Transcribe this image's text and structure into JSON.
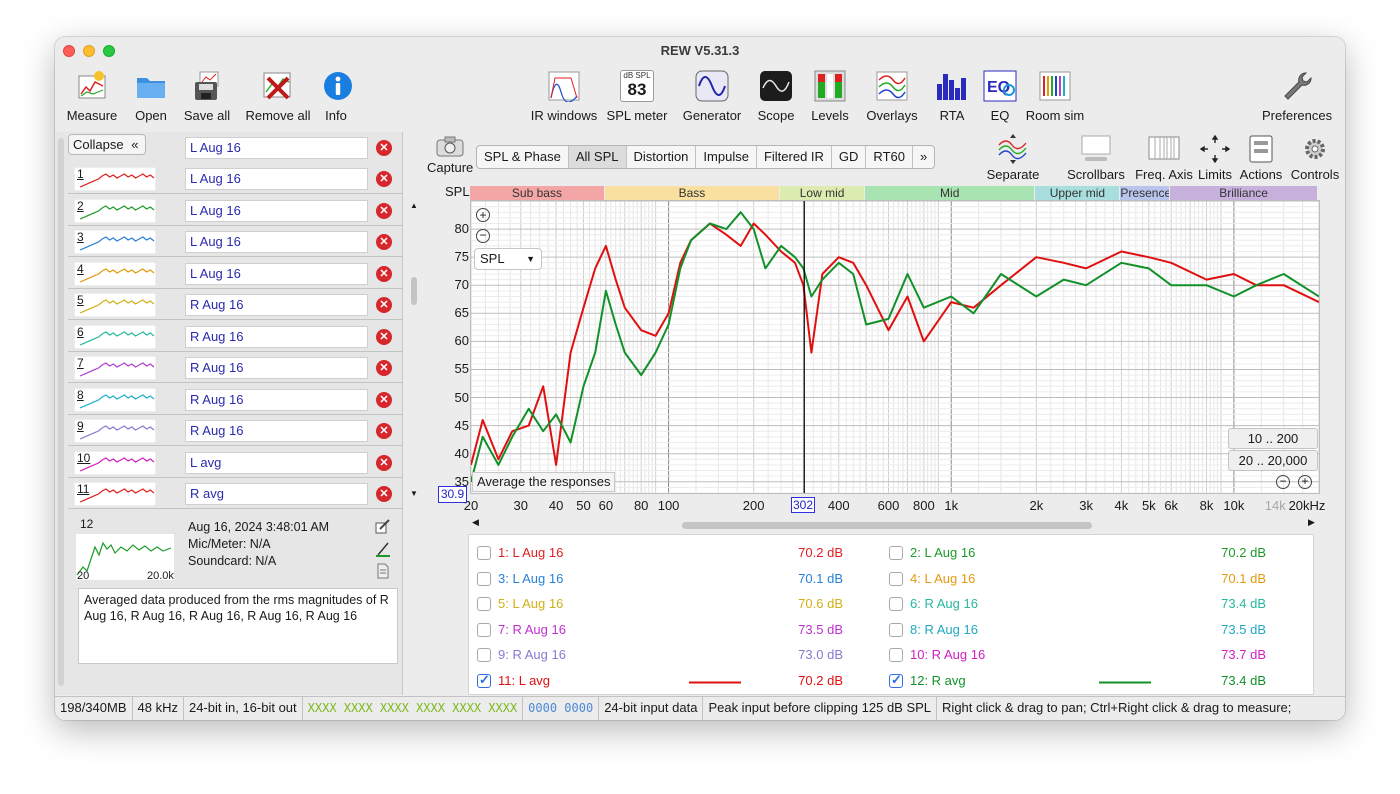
{
  "window": {
    "title": "REW V5.31.3"
  },
  "toolbar": {
    "left": [
      {
        "name": "measure-button",
        "icon": "measure-icon",
        "label": "Measure"
      },
      {
        "name": "open-button",
        "icon": "folder-icon",
        "label": "Open"
      },
      {
        "name": "save-all-button",
        "icon": "save-icon",
        "label": "Save all"
      },
      {
        "name": "remove-all-button",
        "icon": "remove-icon",
        "label": "Remove all"
      },
      {
        "name": "info-button",
        "icon": "info-icon",
        "label": "Info"
      }
    ],
    "center": [
      {
        "name": "ir-windows-button",
        "icon": "ir-windows-icon",
        "label": "IR windows"
      },
      {
        "name": "spl-meter-button",
        "icon": "spl-meter-icon",
        "label": "SPL meter",
        "meter_caption": "dB SPL",
        "meter_value": "83"
      },
      {
        "name": "generator-button",
        "icon": "sine-wave-icon",
        "label": "Generator"
      },
      {
        "name": "scope-button",
        "icon": "scope-icon",
        "label": "Scope"
      },
      {
        "name": "levels-button",
        "icon": "levels-icon",
        "label": "Levels"
      },
      {
        "name": "overlays-button",
        "icon": "overlays-icon",
        "label": "Overlays"
      },
      {
        "name": "rta-button",
        "icon": "rta-icon",
        "label": "RTA"
      },
      {
        "name": "eq-button",
        "icon": "eq-icon",
        "label": "EQ"
      },
      {
        "name": "room-sim-button",
        "icon": "room-sim-icon",
        "label": "Room sim"
      }
    ],
    "right": [
      {
        "name": "preferences-button",
        "icon": "wrench-icon",
        "label": "Preferences"
      }
    ]
  },
  "left_panel": {
    "collapse_label": "Collapse",
    "collapse_glyph": "«",
    "header_name": "L Aug 16",
    "measurements": [
      {
        "num": "1",
        "name": "L Aug 16",
        "color": "#e02020"
      },
      {
        "num": "2",
        "name": "L Aug 16",
        "color": "#1e9a2a"
      },
      {
        "num": "3",
        "name": "L Aug 16",
        "color": "#2a7fd8"
      },
      {
        "num": "4",
        "name": "L Aug 16",
        "color": "#e39a10"
      },
      {
        "num": "5",
        "name": "R Aug 16",
        "color": "#d2b01a"
      },
      {
        "num": "6",
        "name": "R Aug 16",
        "color": "#27b8a0"
      },
      {
        "num": "7",
        "name": "R Aug 16",
        "color": "#b040d0"
      },
      {
        "num": "8",
        "name": "R Aug 16",
        "color": "#20b0c8"
      },
      {
        "num": "9",
        "name": "R Aug 16",
        "color": "#8a7ad0"
      },
      {
        "num": "10",
        "name": "L avg",
        "color": "#d020c0"
      },
      {
        "num": "11",
        "name": "R avg",
        "color": "#e02020"
      }
    ],
    "selected": {
      "num": "12",
      "date": "Aug 16, 2024 3:48:01 AM",
      "mic": "Mic/Meter: N/A",
      "soundcard": "Soundcard: N/A",
      "thumb_left": "20",
      "thumb_right": "20.0k",
      "color": "#1e9a2a",
      "description": "Averaged data produced from the rms magnitudes of R Aug 16, R Aug 16, R Aug 16, R Aug 16, R Aug 16"
    }
  },
  "graph_toolbar": {
    "capture_label": "Capture",
    "tabs": [
      "SPL & Phase",
      "All SPL",
      "Distortion",
      "Impulse",
      "Filtered IR",
      "GD",
      "RT60",
      "»"
    ],
    "active_tab": "All SPL",
    "right_buttons": [
      {
        "name": "separate-button",
        "icon": "separate-icon",
        "label": "Separate"
      },
      {
        "name": "scrollbars-button",
        "icon": "scrollbars-icon",
        "label": "Scrollbars"
      },
      {
        "name": "freq-axis-button",
        "icon": "freq-axis-icon",
        "label": "Freq. Axis"
      },
      {
        "name": "limits-button",
        "icon": "limits-icon",
        "label": "Limits"
      },
      {
        "name": "actions-button",
        "icon": "actions-icon",
        "label": "Actions"
      },
      {
        "name": "controls-button",
        "icon": "gear-icon",
        "label": "Controls"
      }
    ]
  },
  "graph": {
    "spl_label": "SPL",
    "spl_select": "SPL",
    "average_label": "Average the responses",
    "y_min_box": "30.9",
    "cursor_freq": "302",
    "range_buttons": [
      "10 .. 200",
      "20 .. 20,000"
    ],
    "bands": [
      {
        "label": "Sub bass",
        "from": 20,
        "to": 60,
        "color": "#f4a6a6"
      },
      {
        "label": "Bass",
        "from": 60,
        "to": 250,
        "color": "#f9e0a0"
      },
      {
        "label": "Low mid",
        "from": 250,
        "to": 500,
        "color": "#dcecb0"
      },
      {
        "label": "Mid",
        "from": 500,
        "to": 2000,
        "color": "#a8e4b2"
      },
      {
        "label": "Upper mid",
        "from": 2000,
        "to": 4000,
        "color": "#a8dede"
      },
      {
        "label": "Presence",
        "from": 4000,
        "to": 6000,
        "color": "#b8c4ec"
      },
      {
        "label": "Brilliance",
        "from": 6000,
        "to": 20000,
        "color": "#c8b0dc"
      }
    ]
  },
  "chart_data": {
    "type": "line",
    "title": "",
    "xlabel": "",
    "ylabel": "SPL",
    "x_scale": "log",
    "xlim": [
      20,
      20000
    ],
    "ylim": [
      33,
      85
    ],
    "x_ticks": [
      "20",
      "30",
      "40",
      "50",
      "60",
      "80",
      "100",
      "200",
      "302",
      "400",
      "600",
      "800",
      "1k",
      "2k",
      "3k",
      "4k",
      "5k",
      "6k",
      "8k",
      "10k",
      "14k",
      "20kHz"
    ],
    "y_ticks": [
      35,
      40,
      45,
      50,
      55,
      60,
      65,
      70,
      75,
      80
    ],
    "cursor_x": 302,
    "series": [
      {
        "name": "11: L avg",
        "color": "#e01010",
        "x": [
          20,
          22,
          25,
          28,
          32,
          36,
          40,
          45,
          50,
          55,
          60,
          65,
          70,
          80,
          90,
          100,
          110,
          120,
          140,
          160,
          180,
          200,
          220,
          250,
          280,
          300,
          320,
          350,
          400,
          450,
          500,
          600,
          700,
          800,
          1000,
          1200,
          1500,
          2000,
          2500,
          3000,
          4000,
          5000,
          6000,
          8000,
          10000,
          12000,
          15000,
          20000
        ],
        "y": [
          38,
          46,
          39,
          44,
          45,
          52,
          38,
          58,
          66,
          73,
          77,
          71,
          66,
          62,
          61,
          65,
          74,
          78,
          81,
          79,
          77,
          81,
          79,
          76,
          74,
          70,
          58,
          72,
          75,
          74,
          70,
          62,
          68,
          60,
          67,
          66,
          70,
          75,
          74,
          73,
          76,
          75,
          74,
          71,
          72,
          70,
          70,
          67
        ]
      },
      {
        "name": "12: R avg",
        "color": "#12902a",
        "x": [
          20,
          22,
          25,
          28,
          32,
          36,
          40,
          45,
          50,
          55,
          60,
          65,
          70,
          80,
          90,
          100,
          110,
          120,
          140,
          160,
          180,
          200,
          220,
          250,
          280,
          300,
          320,
          350,
          400,
          450,
          500,
          600,
          700,
          800,
          1000,
          1200,
          1500,
          2000,
          2500,
          3000,
          4000,
          5000,
          6000,
          8000,
          10000,
          12000,
          15000,
          20000
        ],
        "y": [
          35,
          43,
          38,
          43,
          48,
          44,
          47,
          42,
          52,
          58,
          69,
          63,
          58,
          54,
          58,
          63,
          73,
          78,
          81,
          80,
          83,
          80,
          73,
          77,
          75,
          73,
          68,
          71,
          74,
          72,
          63,
          64,
          72,
          66,
          68,
          65,
          72,
          68,
          71,
          70,
          74,
          73,
          70,
          70,
          68,
          70,
          72,
          68
        ]
      }
    ]
  },
  "legend": {
    "items": [
      {
        "name": "1: L Aug 16",
        "value": "70.2 dB",
        "color": "#e02020",
        "checked": false
      },
      {
        "name": "2: L Aug 16",
        "value": "70.2 dB",
        "color": "#1e9a2a",
        "checked": false
      },
      {
        "name": "3: L Aug 16",
        "value": "70.1 dB",
        "color": "#2a7fd8",
        "checked": false
      },
      {
        "name": "4: L Aug 16",
        "value": "70.1 dB",
        "color": "#e39a10",
        "checked": false
      },
      {
        "name": "5: L Aug 16",
        "value": "70.6 dB",
        "color": "#d2b01a",
        "checked": false
      },
      {
        "name": "6: R Aug 16",
        "value": "73.4 dB",
        "color": "#27b8a0",
        "checked": false
      },
      {
        "name": "7: R Aug 16",
        "value": "73.5 dB",
        "color": "#c030d0",
        "checked": false
      },
      {
        "name": "8: R Aug 16",
        "value": "73.5 dB",
        "color": "#20a8c0",
        "checked": false
      },
      {
        "name": "9: R Aug 16",
        "value": "73.0 dB",
        "color": "#8a7ad0",
        "checked": false
      },
      {
        "name": "10: R Aug 16",
        "value": "73.7 dB",
        "color": "#d020c0",
        "checked": false
      },
      {
        "name": "11: L avg",
        "value": "70.2 dB",
        "color": "#e01010",
        "checked": true
      },
      {
        "name": "12: R avg",
        "value": "73.4 dB",
        "color": "#12902a",
        "checked": true
      }
    ]
  },
  "status_bar": {
    "memory": "198/340MB",
    "sample_rate": "48 kHz",
    "bit_depth": "24-bit in, 16-bit out",
    "in_levels": "XXXX XXXX  XXXX XXXX  XXXX XXXX",
    "out_levels": "0000 0000",
    "input_data": "24-bit input data",
    "peak": "Peak input before clipping 125 dB SPL",
    "hint": "Right click & drag to pan; Ctrl+Right click & drag to measure;"
  }
}
